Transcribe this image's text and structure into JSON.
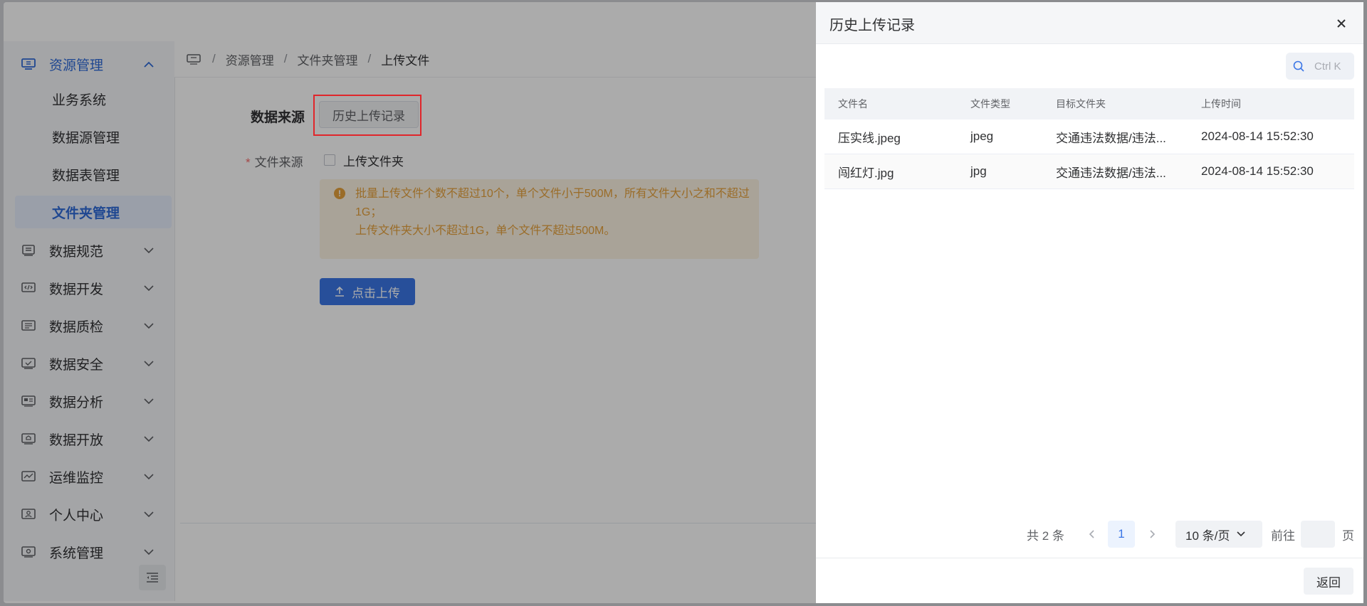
{
  "sidebar": {
    "groups": [
      {
        "label": "资源管理",
        "icon": "monitor-icon",
        "open": true
      },
      {
        "label": "数据规范",
        "icon": "document-icon"
      },
      {
        "label": "数据开发",
        "icon": "code-icon"
      },
      {
        "label": "数据质检",
        "icon": "list-check-icon"
      },
      {
        "label": "数据安全",
        "icon": "shield-check-icon"
      },
      {
        "label": "数据分析",
        "icon": "analysis-icon"
      },
      {
        "label": "数据开放",
        "icon": "open-data-icon"
      },
      {
        "label": "运维监控",
        "icon": "line-chart-icon"
      },
      {
        "label": "个人中心",
        "icon": "user-icon"
      },
      {
        "label": "系统管理",
        "icon": "settings-icon"
      }
    ],
    "sub_items": [
      {
        "label": "业务系统"
      },
      {
        "label": "数据源管理"
      },
      {
        "label": "数据表管理"
      },
      {
        "label": "文件夹管理",
        "active": true
      }
    ]
  },
  "breadcrumb": {
    "items": [
      "资源管理",
      "文件夹管理",
      "上传文件"
    ],
    "separator": "/"
  },
  "form": {
    "data_source_label": "数据来源",
    "history_button": "历史上传记录",
    "file_source_label": "文件来源",
    "required_star": "*",
    "upload_folder_checkbox": "上传文件夹",
    "warning_line1": "批量上传文件个数不超过10个，单个文件小于500M，所有文件大小之和不超过1G；",
    "warning_line2": "上传文件夹大小不超过1G，单个文件不超过500M。",
    "upload_button": "点击上传"
  },
  "drawer": {
    "title": "历史上传记录",
    "search_shortcut": "Ctrl K",
    "columns": [
      "文件名",
      "文件类型",
      "目标文件夹",
      "上传时间"
    ],
    "rows": [
      {
        "name": "压实线.jpeg",
        "type": "jpeg",
        "folder": "交通违法数据/违法...",
        "time": "2024-08-14 15:52:30"
      },
      {
        "name": "闯红灯.jpg",
        "type": "jpg",
        "folder": "交通违法数据/违法...",
        "time": "2024-08-14 15:52:30"
      }
    ],
    "pagination": {
      "total": "共 2 条",
      "current_page": "1",
      "page_size": "10 条/页",
      "goto_label": "前往",
      "page_suffix": "页"
    },
    "back_button": "返回"
  },
  "colors": {
    "primary": "#3b76e6",
    "warning": "#e6a23c",
    "highlight_box": "#e0262b"
  }
}
